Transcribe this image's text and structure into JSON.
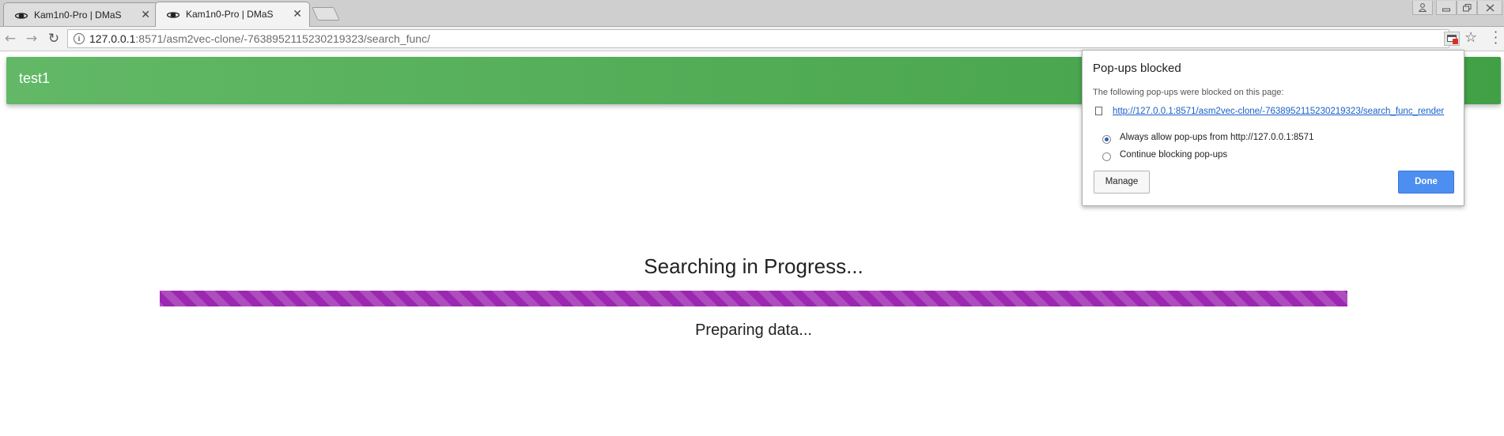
{
  "browser": {
    "tabs": [
      {
        "title": "Kam1n0-Pro | DMaS",
        "close": "✕",
        "active": false
      },
      {
        "title": "Kam1n0-Pro | DMaS",
        "close": "✕",
        "active": true
      }
    ],
    "url_host": "127.0.0.1",
    "url_path": ":8571/asm2vec-clone/-7638952115230219323/search_func/",
    "icons": [
      "back-icon",
      "forward-icon",
      "reload-icon",
      "info-icon",
      "popup-blocked-icon",
      "star-icon",
      "menu-icon",
      "profile-icon",
      "minimize-icon",
      "restore-icon",
      "close-window-icon"
    ]
  },
  "app": {
    "brand": "test1",
    "colors": {
      "appbar": "#4caf50",
      "progress": "#9c27b0"
    }
  },
  "status": {
    "title": "Searching in Progress...",
    "subtitle": "Preparing data...",
    "progress": 1.0
  },
  "popup": {
    "title": "Pop-ups blocked",
    "description": "The following pop-ups were blocked on this page:",
    "link": "http://127.0.0.1:8571/asm2vec-clone/-7638952115230219323/search_func_render",
    "options": [
      {
        "label": "Always allow pop-ups from http://127.0.0.1:8571",
        "selected": true
      },
      {
        "label": "Continue blocking pop-ups",
        "selected": false
      }
    ],
    "manage_label": "Manage",
    "done_label": "Done"
  }
}
